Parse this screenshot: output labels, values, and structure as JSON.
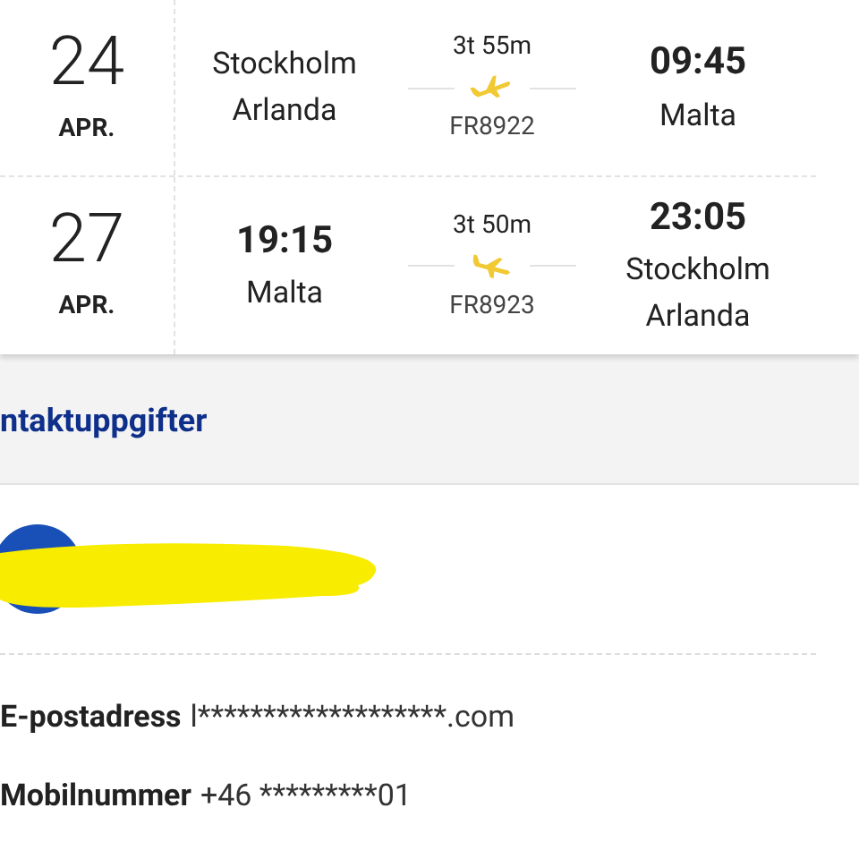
{
  "flights": [
    {
      "day": "24",
      "month": "APR.",
      "departure_place": "Stockholm Arlanda",
      "duration": "3t 55m",
      "flight_number": "FR8922",
      "arrival_time": "09:45",
      "arrival_place": "Malta",
      "kind": "takeoff"
    },
    {
      "day": "27",
      "month": "APR.",
      "departure_time": "19:15",
      "departure_place": "Malta",
      "duration": "3t 50m",
      "flight_number": "FR8923",
      "arrival_time": "23:05",
      "arrival_place": "Stockholm Arlanda",
      "kind": "landing"
    }
  ],
  "contact": {
    "heading": "ntaktuppgifter",
    "fields": [
      {
        "label": "E-postadress",
        "value": "l*******************.com"
      },
      {
        "label": "Mobilnummer",
        "value": "+46 *********01"
      }
    ]
  }
}
